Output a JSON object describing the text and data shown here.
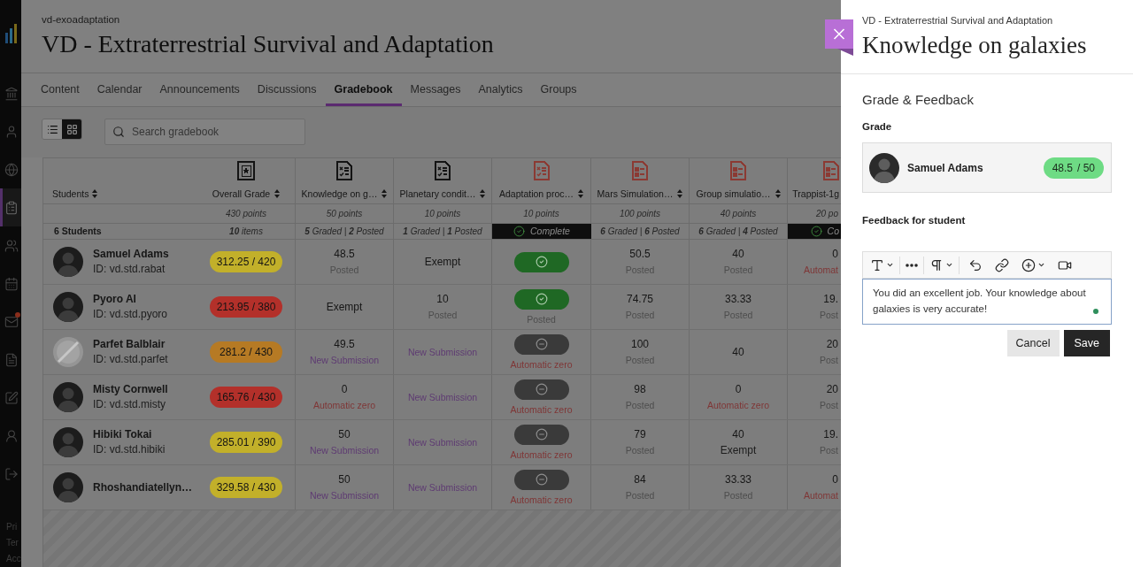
{
  "sidebar": {
    "items": [
      {
        "selected": false,
        "notification": false
      },
      {
        "selected": false,
        "notification": false
      },
      {
        "selected": false,
        "notification": false
      },
      {
        "selected": true,
        "notification": false
      },
      {
        "selected": false,
        "notification": false
      },
      {
        "selected": false,
        "notification": false
      },
      {
        "selected": false,
        "notification": true
      },
      {
        "selected": false,
        "notification": false
      },
      {
        "selected": false,
        "notification": false
      },
      {
        "selected": false,
        "notification": false
      },
      {
        "selected": false,
        "notification": false
      }
    ],
    "footer_links": [
      "Pri",
      "Ter",
      "Acc"
    ]
  },
  "course": {
    "code": "vd-exoadaptation",
    "title": "VD - Extraterrestrial Survival and Adaptation"
  },
  "tabs": [
    {
      "label": "Content",
      "selected": false
    },
    {
      "label": "Calendar",
      "selected": false
    },
    {
      "label": "Announcements",
      "selected": false
    },
    {
      "label": "Discussions",
      "selected": false
    },
    {
      "label": "Gradebook",
      "selected": true
    },
    {
      "label": "Messages",
      "selected": false
    },
    {
      "label": "Analytics",
      "selected": false
    },
    {
      "label": "Groups",
      "selected": false
    }
  ],
  "toolbar": {
    "views": [
      {
        "selected": false
      },
      {
        "selected": true
      }
    ],
    "search": {
      "placeholder": "Search gradebook"
    }
  },
  "gradebook": {
    "columns": [
      {
        "kind": "students",
        "label": "Students",
        "summary": {
          "kind": "count",
          "text": "6 Students"
        }
      },
      {
        "kind": "overall",
        "color": "#141414",
        "label": "Overall Grade",
        "points": "430 points",
        "summary": {
          "kind": "count",
          "text": "**10** items"
        }
      },
      {
        "kind": "test",
        "color": "#141414",
        "label": "Knowledge on g…",
        "points": "50 points",
        "summary": {
          "kind": "count",
          "text": "**5** Graded | **2** Posted"
        }
      },
      {
        "kind": "test",
        "color": "#141414",
        "label": "Planetary condit…",
        "points": "10 points",
        "summary": {
          "kind": "count",
          "text": "**1** Graded | **1** Posted"
        }
      },
      {
        "kind": "test",
        "color": "#8b3a33",
        "label": "Adaptation proc…",
        "points": "10 points",
        "summary": {
          "kind": "complete",
          "text": "Complete"
        }
      },
      {
        "kind": "assignment",
        "color": "#8b3a33",
        "label": "Mars Simulation…",
        "points": "100 points",
        "summary": {
          "kind": "count",
          "text": "**6** Graded | **6** Posted"
        }
      },
      {
        "kind": "assignment",
        "color": "#8b3a33",
        "label": "Group simulatio…",
        "points": "40 points",
        "summary": {
          "kind": "count",
          "text": "**6** Graded | **4** Posted"
        }
      },
      {
        "kind": "assignment",
        "color": "#8b3a33",
        "label": "Trappist-1g",
        "points": "20 po",
        "summary": {
          "kind": "complete",
          "text": "Co"
        }
      }
    ],
    "rows": [
      {
        "cells": [
          {
            "kind": "student",
            "name": "Samuel Adams",
            "id": "ID: vd.std.rabat",
            "avatar": {
              "kind": "silhouette"
            }
          },
          {
            "kind": "overall",
            "text": "312.25 / 420",
            "color": "#c2b02a"
          },
          {
            "kind": "grade",
            "value": "48.5",
            "note": {
              "kind": "posted",
              "text": "Posted"
            }
          },
          {
            "kind": "grade",
            "value": "Exempt"
          },
          {
            "kind": "completion",
            "complete": true
          },
          {
            "kind": "grade",
            "value": "50.5",
            "note": {
              "kind": "posted",
              "text": "Posted"
            }
          },
          {
            "kind": "grade",
            "value": "40",
            "note": {
              "kind": "posted",
              "text": "Posted"
            }
          },
          {
            "kind": "grade",
            "value": "0",
            "note": {
              "kind": "zero",
              "text": "Automat"
            }
          }
        ]
      },
      {
        "cells": [
          {
            "kind": "student",
            "name": "Pyoro AI",
            "id": "ID: vd.std.pyoro",
            "avatar": {
              "kind": "silhouette"
            }
          },
          {
            "kind": "overall",
            "text": "213.95 / 380",
            "color": "#b3302a"
          },
          {
            "kind": "grade",
            "value": "Exempt"
          },
          {
            "kind": "grade",
            "value": "10",
            "note": {
              "kind": "posted",
              "text": "Posted"
            }
          },
          {
            "kind": "completion",
            "complete": true,
            "note": {
              "kind": "posted",
              "text": "Posted"
            }
          },
          {
            "kind": "grade",
            "value": "74.75",
            "note": {
              "kind": "posted",
              "text": "Posted"
            }
          },
          {
            "kind": "grade",
            "value": "33.33",
            "note": {
              "kind": "posted",
              "text": "Posted"
            }
          },
          {
            "kind": "grade",
            "value": "19.",
            "note": {
              "kind": "posted",
              "text": "Post"
            }
          }
        ]
      },
      {
        "cells": [
          {
            "kind": "student",
            "name": "Parfet Balblair",
            "id": "ID: vd.std.parfet",
            "avatar": {
              "kind": "struck"
            }
          },
          {
            "kind": "overall",
            "text": "281.2 / 430",
            "color": "#b67a24"
          },
          {
            "kind": "grade",
            "value": "49.5",
            "note": {
              "kind": "new",
              "text": "New Submission"
            }
          },
          {
            "kind": "grade",
            "note": {
              "kind": "new",
              "text": "New Submission"
            }
          },
          {
            "kind": "completion",
            "complete": false,
            "note": {
              "kind": "zero",
              "text": "Automatic zero"
            }
          },
          {
            "kind": "grade",
            "value": "100",
            "note": {
              "kind": "posted",
              "text": "Posted"
            }
          },
          {
            "kind": "grade",
            "value": "40"
          },
          {
            "kind": "grade",
            "value": "20",
            "note": {
              "kind": "posted",
              "text": "Post"
            }
          }
        ]
      },
      {
        "cells": [
          {
            "kind": "student",
            "name": "Misty Cornwell",
            "id": "ID: vd.std.misty",
            "avatar": {
              "kind": "silhouette"
            }
          },
          {
            "kind": "overall",
            "text": "165.76 / 430",
            "color": "#b3302a"
          },
          {
            "kind": "grade",
            "value": "0",
            "note": {
              "kind": "zero",
              "text": "Automatic zero"
            }
          },
          {
            "kind": "grade",
            "note": {
              "kind": "new",
              "text": "New Submission"
            }
          },
          {
            "kind": "completion",
            "complete": false,
            "note": {
              "kind": "zero",
              "text": "Automatic zero"
            }
          },
          {
            "kind": "grade",
            "value": "98",
            "note": {
              "kind": "posted",
              "text": "Posted"
            }
          },
          {
            "kind": "grade",
            "value": "0",
            "note": {
              "kind": "zero",
              "text": "Automatic zero"
            }
          },
          {
            "kind": "grade",
            "value": "20",
            "note": {
              "kind": "posted",
              "text": "Post"
            }
          }
        ]
      },
      {
        "cells": [
          {
            "kind": "student",
            "name": "Hibiki Tokai",
            "id": "ID: vd.std.hibiki",
            "avatar": {
              "kind": "silhouette"
            }
          },
          {
            "kind": "overall",
            "text": "285.01 / 390",
            "color": "#c2b02a"
          },
          {
            "kind": "grade",
            "value": "50",
            "note": {
              "kind": "new",
              "text": "New Submission"
            }
          },
          {
            "kind": "grade",
            "note": {
              "kind": "new",
              "text": "New Submission"
            }
          },
          {
            "kind": "completion",
            "complete": false,
            "note": {
              "kind": "zero",
              "text": "Automatic zero"
            }
          },
          {
            "kind": "grade",
            "value": "79",
            "note": {
              "kind": "posted",
              "text": "Posted"
            }
          },
          {
            "kind": "grade",
            "value": "40",
            "note": {
              "kind": "exempt",
              "text": "Exempt"
            }
          },
          {
            "kind": "grade",
            "value": "19.",
            "note": {
              "kind": "posted",
              "text": "Post"
            }
          }
        ]
      },
      {
        "cells": [
          {
            "kind": "student",
            "name": "Rhoshandiatellyn…",
            "avatar": {
              "kind": "silhouette"
            }
          },
          {
            "kind": "overall",
            "text": "329.58 / 430",
            "color": "#c2b02a"
          },
          {
            "kind": "grade",
            "value": "50",
            "note": {
              "kind": "new",
              "text": "New Submission"
            }
          },
          {
            "kind": "grade",
            "note": {
              "kind": "new",
              "text": "New Submission"
            }
          },
          {
            "kind": "completion",
            "complete": false,
            "note": {
              "kind": "zero",
              "text": "Automatic zero"
            }
          },
          {
            "kind": "grade",
            "value": "84",
            "note": {
              "kind": "posted",
              "text": "Posted"
            }
          },
          {
            "kind": "grade",
            "value": "33.33",
            "note": {
              "kind": "posted",
              "text": "Posted"
            }
          },
          {
            "kind": "grade",
            "value": "0",
            "note": {
              "kind": "zero",
              "text": "Automat"
            }
          }
        ]
      }
    ]
  },
  "panel": {
    "course": "VD - Extraterrestrial Survival and Adaptation",
    "title": "Knowledge on galaxies",
    "section": "Grade & Feedback",
    "grade_label": "Grade",
    "student": {
      "name": "Samuel Adams",
      "grade": "48.5",
      "max": "/ 50"
    },
    "feedback_label": "Feedback for student",
    "feedback": "You did an excellent job. Your knowledge about galaxies is very accurate!",
    "buttons": [
      {
        "kind": "secondary",
        "label": "Cancel"
      },
      {
        "kind": "primary",
        "label": "Save"
      }
    ]
  }
}
